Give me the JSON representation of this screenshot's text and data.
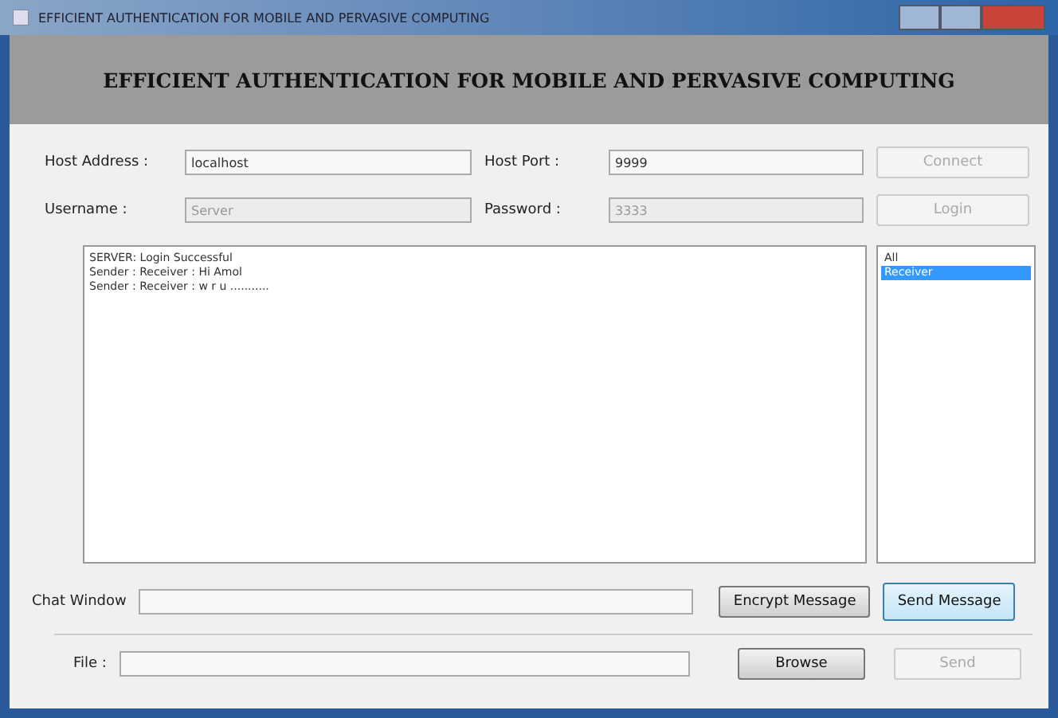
{
  "window": {
    "title": "EFFICIENT AUTHENTICATION FOR MOBILE AND PERVASIVE COMPUTING"
  },
  "header": "EFFICIENT AUTHENTICATION FOR MOBILE AND PERVASIVE COMPUTING",
  "fields": [
    {
      "label": "Host Address :",
      "value": "localhost",
      "disabled": false
    },
    {
      "label": "Host Port :",
      "value": "9999",
      "disabled": false
    },
    {
      "label": "Username :",
      "value": "Server",
      "disabled": true
    },
    {
      "label": "Password :",
      "value": "3333",
      "disabled": true
    }
  ],
  "connect_buttons": [
    {
      "label": "Connect",
      "disabled": true
    },
    {
      "label": "Login",
      "disabled": true
    }
  ],
  "messages": [
    "SERVER: Login Successful",
    "Sender : Receiver : Hi Amol",
    "Sender : Receiver : w r u ..........."
  ],
  "recipients": [
    {
      "label": "All",
      "selected": false
    },
    {
      "label": "Receiver",
      "selected": true
    }
  ],
  "chat": {
    "label": "Chat Window",
    "buttons": [
      {
        "label": "Encrypt Message",
        "disabled": false
      },
      {
        "label": "Send Message",
        "disabled": false
      }
    ]
  },
  "file": {
    "label": "File :",
    "buttons": [
      {
        "label": "Browse",
        "disabled": false
      },
      {
        "label": "Send",
        "disabled": true
      }
    ]
  }
}
